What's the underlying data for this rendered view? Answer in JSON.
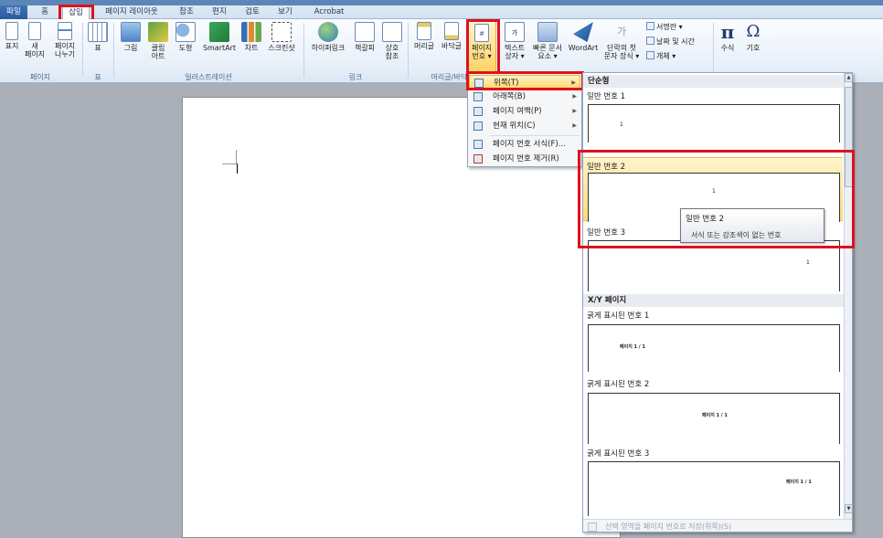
{
  "titlebar": {
    "text": ""
  },
  "tabs": [
    {
      "label": "파일"
    },
    {
      "label": "홈"
    },
    {
      "label": "삽입"
    },
    {
      "label": "페이지 레이아웃"
    },
    {
      "label": "참조"
    },
    {
      "label": "편지"
    },
    {
      "label": "검토"
    },
    {
      "label": "보기"
    },
    {
      "label": "Acrobat"
    }
  ],
  "ribbon": {
    "groups": {
      "pages": "페이지",
      "table": "표",
      "illustrations": "일러스트레이션",
      "links": "링크",
      "header_footer": "머리글/바닥글"
    },
    "buttons": {
      "cover": "표지",
      "new_page_1": "새",
      "new_page_2": "페이지",
      "page_break_1": "페이지",
      "page_break_2": "나누기",
      "table": "표",
      "picture": "그림",
      "clipart_1": "클립",
      "clipart_2": "아트",
      "shapes": "도형",
      "smartart": "SmartArt",
      "chart": "차트",
      "screenshot": "스크린샷",
      "hyperlink": "하이퍼링크",
      "bookmark": "책갈피",
      "crossref_1": "상호",
      "crossref_2": "참조",
      "header": "머리글",
      "footer": "바닥글",
      "page_number_1": "페이지",
      "page_number_2": "번호 ▾",
      "textbox_1": "텍스트",
      "textbox_2": "상자 ▾",
      "quickparts_1": "빠른 문서",
      "quickparts_2": "요소 ▾",
      "wordart": "WordArt",
      "dropcap_1": "단락의 첫",
      "dropcap_2": "문자 장식 ▾",
      "signature": "서명란 ▾",
      "datetime": "날짜 및 시간",
      "object": "개체 ▾",
      "equation": "수식",
      "symbol": "기호"
    }
  },
  "menu": {
    "items": [
      {
        "label": "위쪽(T)",
        "has_arrow": true
      },
      {
        "label": "아래쪽(B)",
        "has_arrow": true
      },
      {
        "label": "페이지 여백(P)",
        "has_arrow": true
      },
      {
        "label": "현재 위치(C)",
        "has_arrow": true
      },
      {
        "label": "페이지 번호 서식(F)...",
        "has_arrow": false
      },
      {
        "label": "페이지 번호 제거(R)",
        "has_arrow": false
      }
    ]
  },
  "gallery": {
    "category_simple": "단순형",
    "plain1": "일반 번호 1",
    "plain2": "일반 번호 2",
    "plain3": "일반 번호 3",
    "num1": "1",
    "category_xy": "X/Y 페이지",
    "bold1": "굵게 표시된 번호 1",
    "bold2": "굵게 표시된 번호 2",
    "bold3": "굵게 표시된 번호 3",
    "xy_text": "페이지 1 / 1",
    "footer": "선택 영역을 페이지 번호로 저장(위쪽)(S)"
  },
  "tooltip": {
    "title": "일반 번호 2",
    "description": "서식 또는 강조색이 없는 번호"
  },
  "colors": {
    "highlight_red": "#e0111d",
    "menu_highlight": "#ffd96d",
    "file_tab": "#2a5a9e"
  }
}
